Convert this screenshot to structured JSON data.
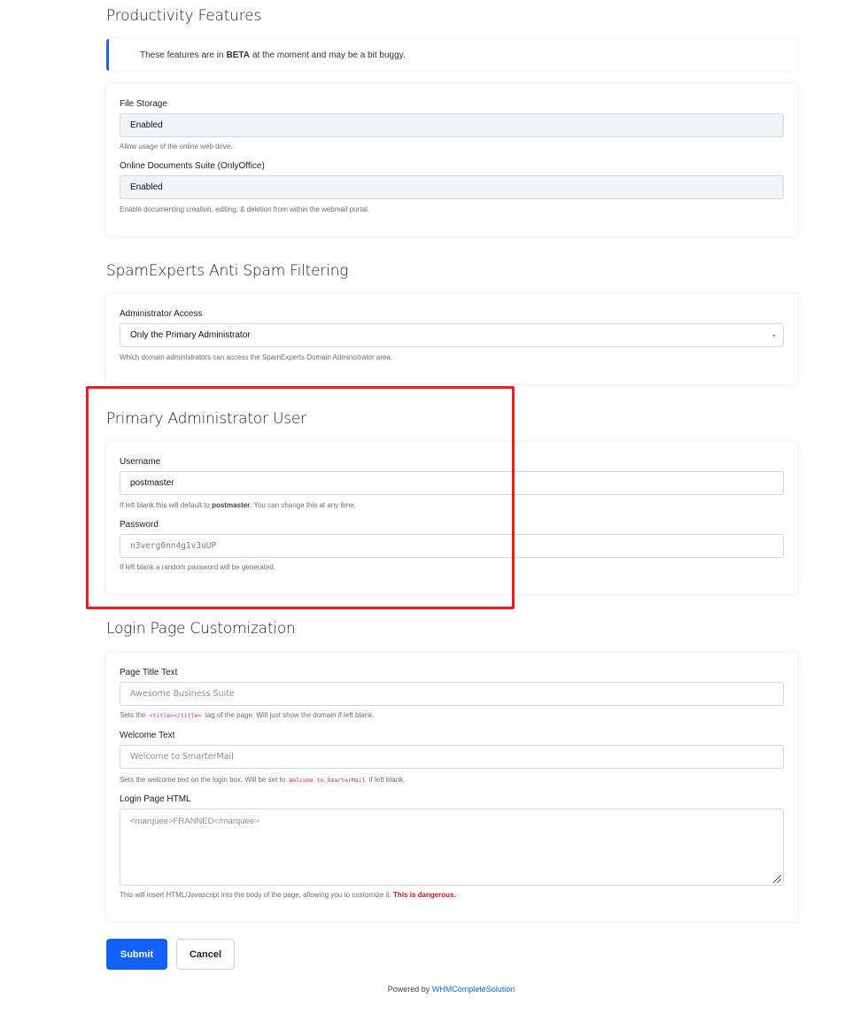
{
  "productivity": {
    "title": "Productivity Features",
    "alert": {
      "prefix": "These features are in",
      "bold": "BETA",
      "suffix": "at the moment and may be a bit buggy."
    },
    "file_storage": {
      "label": "File Storage",
      "value": "Enabled",
      "help": "Allow usage of the online web drive.."
    },
    "online_docs": {
      "label": "Online Documents Suite (OnlyOffice)",
      "value": "Enabled",
      "help": "Enable documenting creation, editing, & deletion from within the webmail portal."
    }
  },
  "spamexperts": {
    "title": "SpamExperts Anti Spam Filtering",
    "admin_access": {
      "label": "Administrator Access",
      "value": "Only the Primary Administrator",
      "help": "Which domain administrators can access the SpamExperts Domain Administrator area."
    }
  },
  "primary_admin": {
    "title": "Primary Administrator User",
    "username": {
      "label": "Username",
      "value": "postmaster",
      "help_prefix": "If left blank this will default to",
      "help_bold": "postmaster",
      "help_suffix": ". You can change this at any time."
    },
    "password": {
      "label": "Password",
      "placeholder": "n3verg0nn4g1v3uUP",
      "help": "If left blank a random password will be generated."
    }
  },
  "login_page": {
    "title": "Login Page Customization",
    "page_title": {
      "label": "Page Title Text",
      "placeholder": "Awesome Business Suite",
      "help_prefix": "Sets the",
      "help_code": "<title></title>",
      "help_suffix": "tag of the page. Will just show the domain if left blank."
    },
    "welcome": {
      "label": "Welcome Text",
      "placeholder": "Welcome to SmarterMail",
      "help_prefix": "Sets the welcome text on the login box. Will be set to",
      "help_code": "Welcome to SmarterMail",
      "help_suffix": "if left blank."
    },
    "login_html": {
      "label": "Login Page HTML",
      "placeholder": "<marquee>FRANNED</marquee>",
      "help_prefix": "This will insert HTML/Javascript into the body of the page, allowing you to customize it.",
      "help_danger": "This is dangerous."
    }
  },
  "buttons": {
    "submit": "Submit",
    "cancel": "Cancel"
  },
  "footer": {
    "prefix": "Powered by",
    "link": "WHMCompleteSolution"
  },
  "colors": {
    "primary": "#1260f5",
    "highlight": "#ee1c1c",
    "danger": "#c0191b"
  }
}
